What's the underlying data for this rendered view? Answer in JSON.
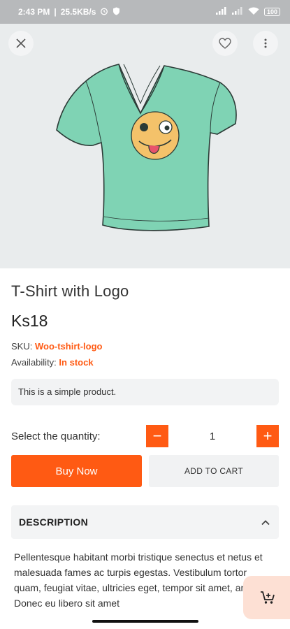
{
  "status_bar": {
    "time": "2:43 PM",
    "separator": "|",
    "speed": "25.5KB/s",
    "battery": "100"
  },
  "hero": {
    "image": "t-shirt-with-emoji-logo",
    "background": "#e9eced"
  },
  "product": {
    "title": "T-Shirt with Logo",
    "price": "Ks18",
    "sku_label": "SKU:",
    "sku_value": "Woo-tshirt-logo",
    "availability_label": "Availability:",
    "availability_value": "In stock",
    "short_description": "This is a simple product."
  },
  "quantity": {
    "label": "Select the quantity:",
    "value": "1",
    "minus": "−",
    "plus": "+"
  },
  "actions": {
    "buy_now": "Buy Now",
    "add_to_cart": "ADD TO CART"
  },
  "description": {
    "header": "DESCRIPTION",
    "body": "Pellentesque habitant morbi tristique senectus et netus et malesuada fames ac turpis egestas. Vestibulum tortor quam, feugiat vitae, ultricies eget, tempor sit amet, ante. Donec eu libero sit amet"
  },
  "colors": {
    "accent": "#ff5a13",
    "fab_bg": "#fde0d4",
    "shirt": "#7fd3b4"
  }
}
